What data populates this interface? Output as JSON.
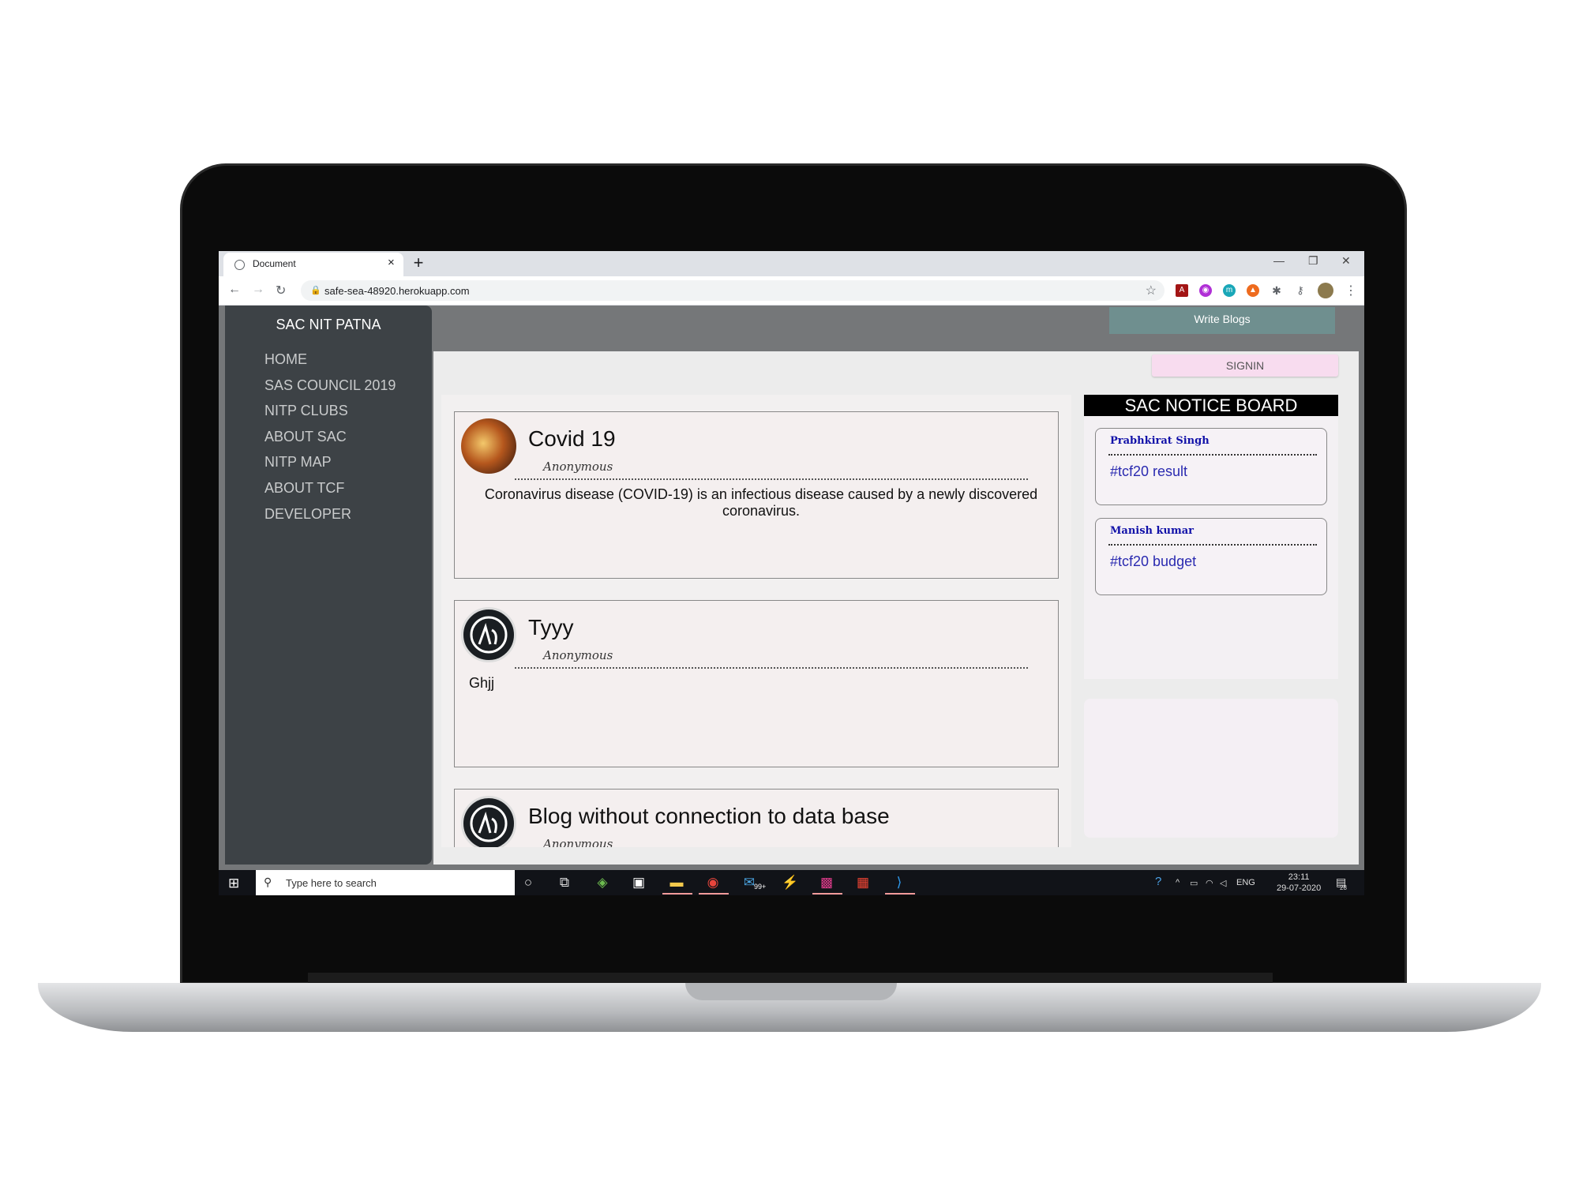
{
  "browser": {
    "tab_title": "Document",
    "url": "safe-sea-48920.herokuapp.com"
  },
  "site": {
    "brand": "SAC NIT PATNA",
    "nav": [
      "HOME",
      "SAS COUNCIL 2019",
      "NITP CLUBS",
      "ABOUT SAC",
      "NITP MAP",
      "ABOUT TCF",
      "DEVELOPER"
    ],
    "write_blogs_label": "Write Blogs",
    "signin_label": "SIGNIN"
  },
  "posts": [
    {
      "title": "Covid 19",
      "author": "Anonymous",
      "body": "Coronavirus disease (COVID-19) is an infectious disease caused by a newly discovered coronavirus."
    },
    {
      "title": "Tyyy",
      "author": "Anonymous",
      "body": "Ghjj"
    },
    {
      "title": "Blog without connection to data base",
      "author": "Anonymous",
      "body": ""
    }
  ],
  "notice_board": {
    "title": "SAC NOTICE BOARD",
    "items": [
      {
        "author": "Prabhkirat Singh",
        "tag": "#tcf20 result"
      },
      {
        "author": "Manish kumar",
        "tag": "#tcf20 budget"
      }
    ]
  },
  "taskbar": {
    "search_placeholder": "Type here to search",
    "language": "ENG",
    "time": "23:11",
    "date": "29-07-2020",
    "mail_badge": "99+",
    "notification_count": "28"
  }
}
